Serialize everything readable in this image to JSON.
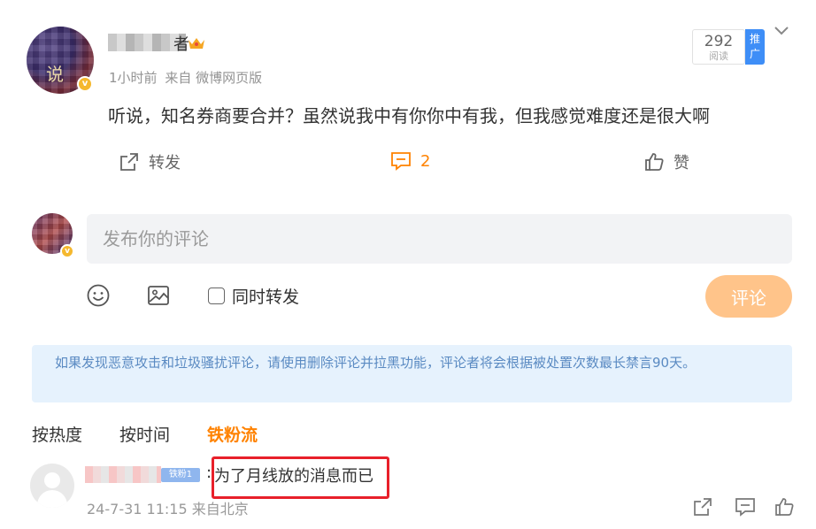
{
  "post": {
    "author_tail": "者",
    "meta_time": "1小时前",
    "meta_source": "来自 微博网页版",
    "read_count": "292",
    "read_label": "阅读",
    "promo_label": "推广",
    "text": "听说，知名券商要合并？虽然说我中有你你中有我，但我感觉难度还是很大啊",
    "actions": {
      "repost_label": "转发",
      "comment_count": "2",
      "like_label": "赞"
    }
  },
  "composer": {
    "placeholder": "发布你的评论",
    "repost_checkbox_label": "同时转发",
    "submit_label": "评论"
  },
  "notice": "如果发现恶意攻击和垃圾骚扰评论，请使用删除评论并拉黑功能，评论者将会根据被处置次数最长禁言90天。",
  "sort_tabs": [
    {
      "label": "按热度",
      "active": false
    },
    {
      "label": "按时间",
      "active": false
    },
    {
      "label": "铁粉流",
      "active": true
    }
  ],
  "comments": [
    {
      "fan_badge": "铁粉1",
      "text": "为了月线放的消息而已",
      "time": "24-7-31 11:15 来自北京"
    }
  ],
  "colors": {
    "accent": "#ff8200",
    "submit_disabled": "#ffc48a",
    "notice_bg": "#e6f2fd",
    "highlight": "#e8202a"
  }
}
